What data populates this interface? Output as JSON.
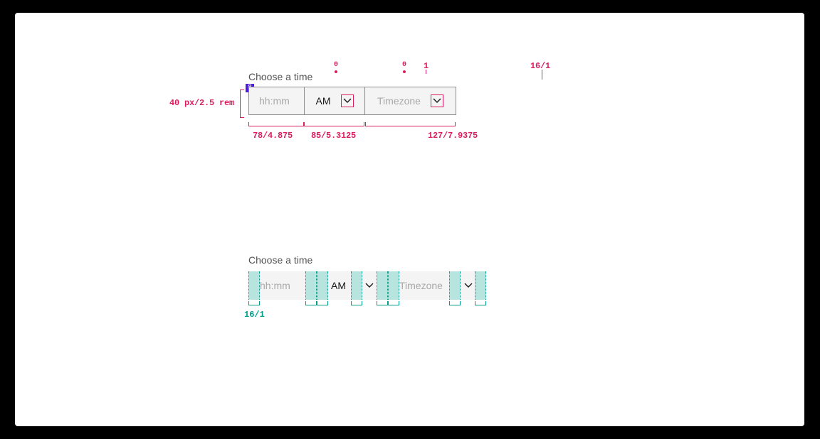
{
  "spec1": {
    "label": "Choose a time",
    "badge": "8",
    "time_placeholder": "hh:mm",
    "ampm_value": "AM",
    "tz_placeholder": "Timezone",
    "height_ann": "40 px/2.5 rem",
    "top_gap_ann": "1",
    "chev_ann": "16/1",
    "width_time": "78/4.875",
    "width_ampm": "85/5.3125",
    "width_tz": "127/7.9375",
    "zero_a": "0",
    "zero_b": "0"
  },
  "spec2": {
    "label": "Choose a time",
    "time_placeholder": "hh:mm",
    "ampm_value": "AM",
    "tz_placeholder": "Timezone",
    "spacing_ann": "16/1"
  },
  "colors": {
    "pink": "#da1e60",
    "teal": "#009e8b",
    "purple": "#4b1fd8",
    "placeholder": "#a8a8a8",
    "text": "#161616",
    "label": "#525252",
    "field_bg": "#f4f4f4",
    "border": "#8d8d8d"
  }
}
